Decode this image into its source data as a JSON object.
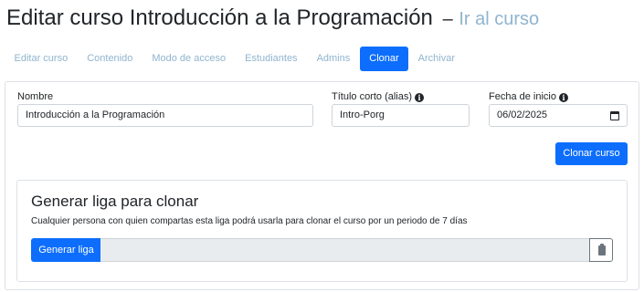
{
  "header": {
    "title": "Editar curso Introducción a la Programación",
    "separator": "–",
    "go_to_course_link": "Ir al curso"
  },
  "tabs": [
    {
      "label": "Editar curso",
      "active": false
    },
    {
      "label": "Contenido",
      "active": false
    },
    {
      "label": "Modo de acceso",
      "active": false
    },
    {
      "label": "Estudiantes",
      "active": false
    },
    {
      "label": "Admins",
      "active": false
    },
    {
      "label": "Clonar",
      "active": true
    },
    {
      "label": "Archivar",
      "active": false
    }
  ],
  "clone_form": {
    "name_label": "Nombre",
    "name_value": "Introducción a la Programación",
    "alias_label": "Título corto (alias)",
    "alias_value": "Intro-Porg",
    "start_date_label": "Fecha de inicio",
    "start_date_value": "06/02/2025",
    "submit_label": "Clonar curso"
  },
  "clone_link": {
    "title": "Generar liga para clonar",
    "description": "Cualquier persona con quien compartas esta liga podrá usarla para clonar el curso por un periodo de 7 días",
    "generate_label": "Generar liga",
    "link_value": ""
  },
  "icons": {
    "info": "info-circle-icon",
    "calendar": "calendar-icon",
    "copy": "clipboard-icon"
  },
  "colors": {
    "primary": "#0d6efd",
    "link": "#8fb4cf",
    "border": "#dee2e6",
    "readonly_bg": "#e9ecef"
  }
}
